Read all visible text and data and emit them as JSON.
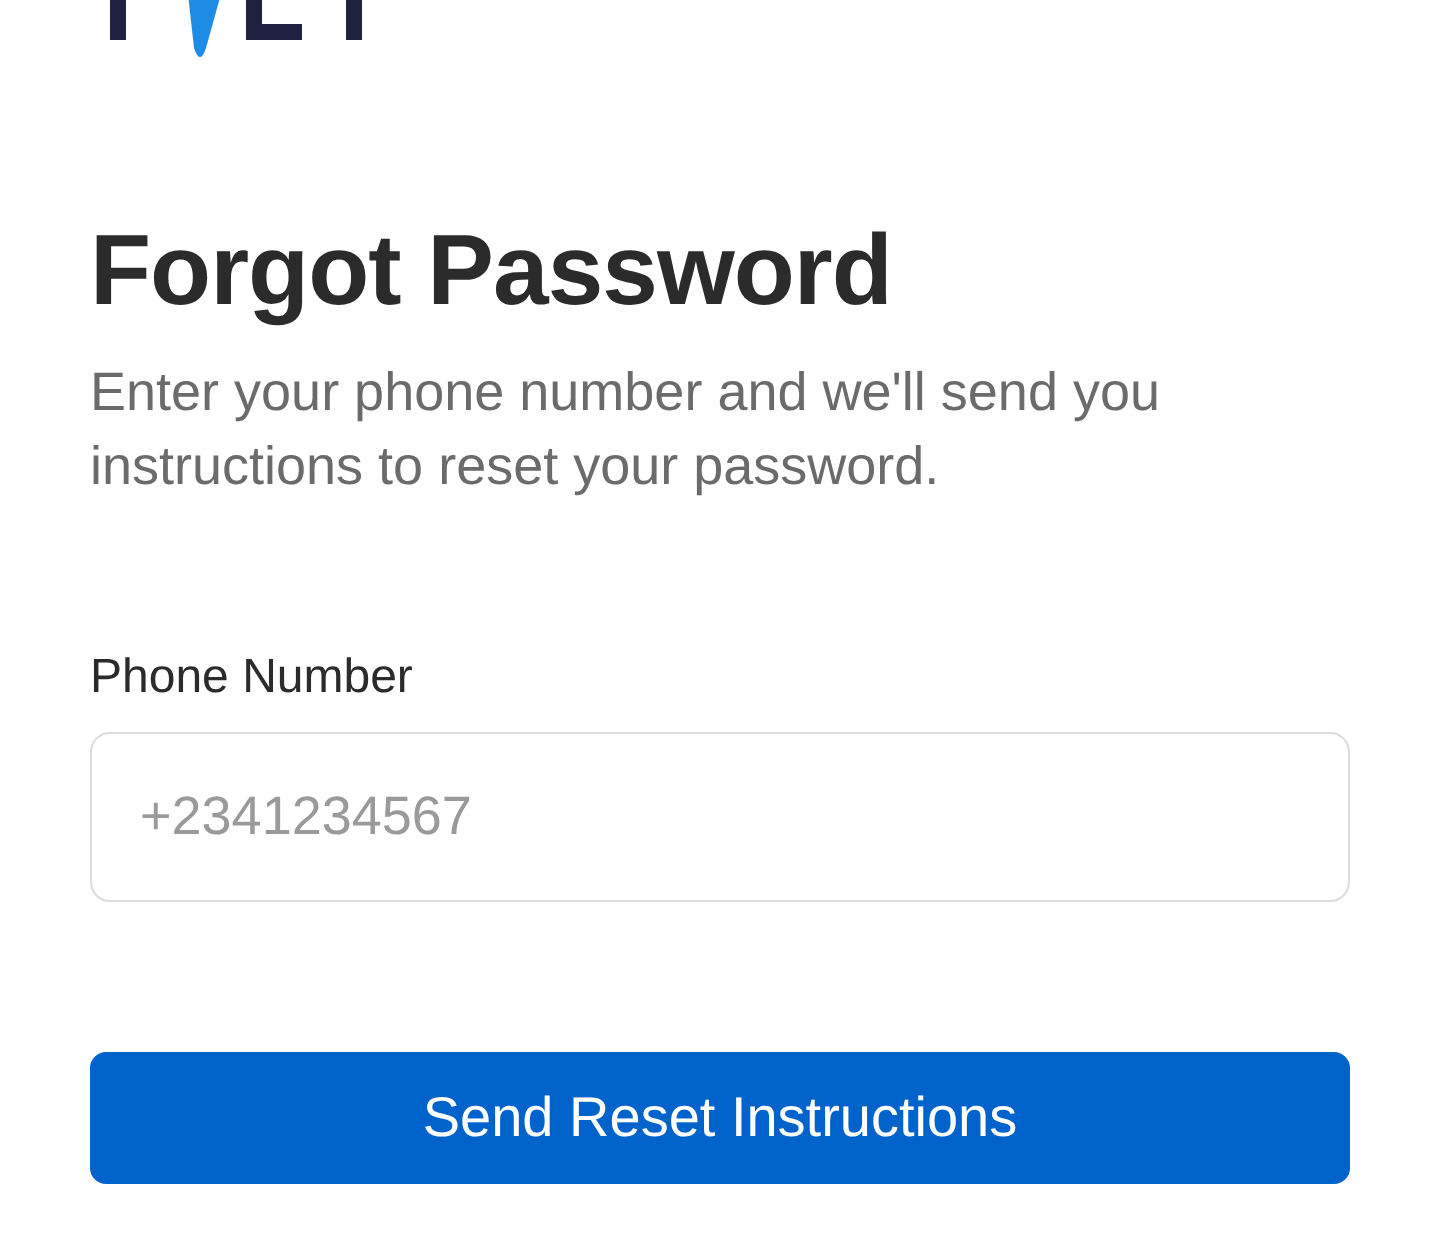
{
  "title": "Forgot Password",
  "subtitle": "Enter your phone number and we'll send you instructions to reset your password.",
  "phone_field": {
    "label": "Phone Number",
    "placeholder": "+2341234567"
  },
  "submit_button": {
    "label": "Send Reset Instructions"
  }
}
